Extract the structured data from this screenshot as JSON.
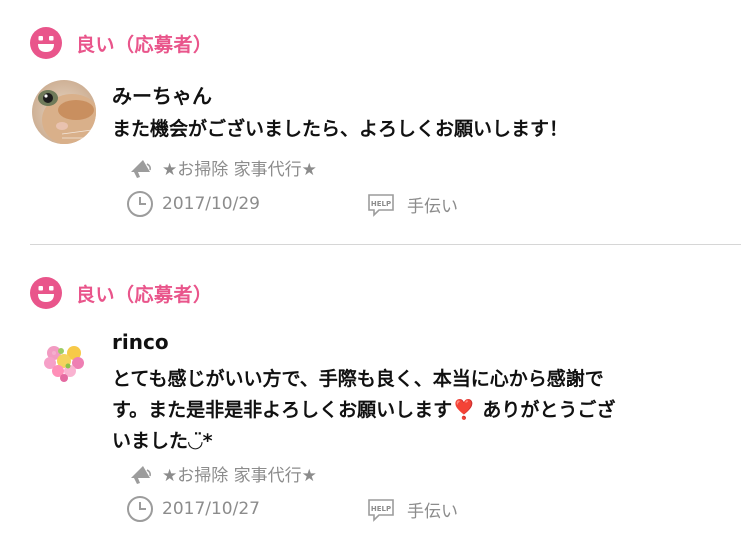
{
  "reviews": [
    {
      "rating_label": "良い（応募者）",
      "name": "みーちゃん",
      "comment_lines": [
        "また機会がございましたら、よろしくお願いします！"
      ],
      "job": "★お掃除 家事代行★",
      "date": "2017/10/29",
      "help_badge": "HELP",
      "type": "手伝い",
      "avatar": "cat-photo"
    },
    {
      "rating_label": "良い（応募者）",
      "name": "rinco",
      "comment_lines": [
        "とても感じがいい方で、手際も良く、本当に心から感謝で",
        "す。また是非是非よろしくお願いします",
        "❣️",
        " ありがとうござ",
        "いました◡̈*"
      ],
      "job": "★お掃除 家事代行★",
      "date": "2017/10/27",
      "help_badge": "HELP",
      "type": "手伝い",
      "avatar": "flower-heart"
    }
  ],
  "colors": {
    "accent": "#e9558b",
    "meta": "#8c8c8c",
    "divider": "#d6d6d6"
  },
  "icons": [
    "smiley-icon",
    "megaphone-icon",
    "clock-icon",
    "help-bubble-icon"
  ]
}
